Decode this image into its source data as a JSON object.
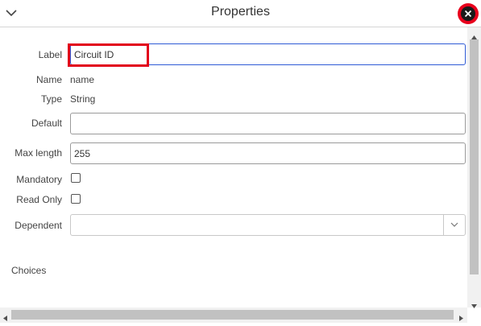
{
  "header": {
    "title": "Properties",
    "collapse_icon": "chevron-down-icon",
    "close_icon": "close-icon",
    "close_color": "#e8001c"
  },
  "fields": {
    "label": {
      "label": "Label",
      "value": "Circuit ID"
    },
    "name": {
      "label": "Name",
      "value": "name"
    },
    "type": {
      "label": "Type",
      "value": "String"
    },
    "default": {
      "label": "Default",
      "value": ""
    },
    "max_length": {
      "label": "Max length",
      "value": "255"
    },
    "mandatory": {
      "label": "Mandatory",
      "checked": false
    },
    "read_only": {
      "label": "Read Only",
      "checked": false
    },
    "dependent": {
      "label": "Dependent",
      "value": ""
    }
  },
  "choices": {
    "title": "Choices"
  },
  "colors": {
    "highlight": "#e2001a",
    "focus_border": "#2f5bd6"
  }
}
